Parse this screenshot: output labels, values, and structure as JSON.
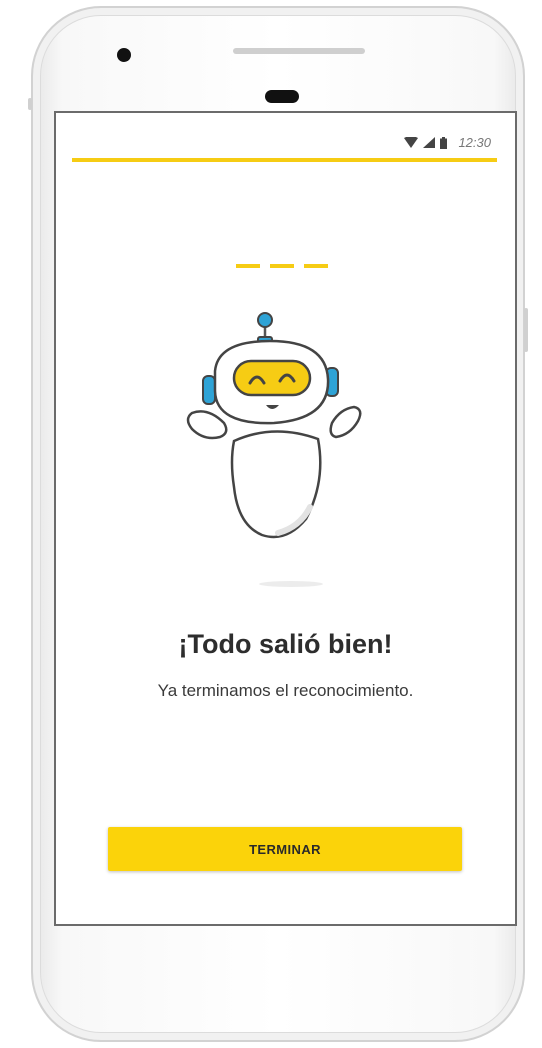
{
  "statusbar": {
    "time": "12:30",
    "icons": [
      "wifi-icon",
      "cell-signal-icon",
      "battery-icon"
    ]
  },
  "success": {
    "title": "¡Todo salió bien!",
    "message": "Ya terminamos el reconocimiento."
  },
  "actions": {
    "finish_label": "TERMINAR"
  },
  "colors": {
    "accent": "#f6cc14",
    "button": "#fbd30a",
    "robot_ear": "#2ea3d6",
    "text_dark": "#2d2d2d"
  },
  "illustration": "robot-icon"
}
